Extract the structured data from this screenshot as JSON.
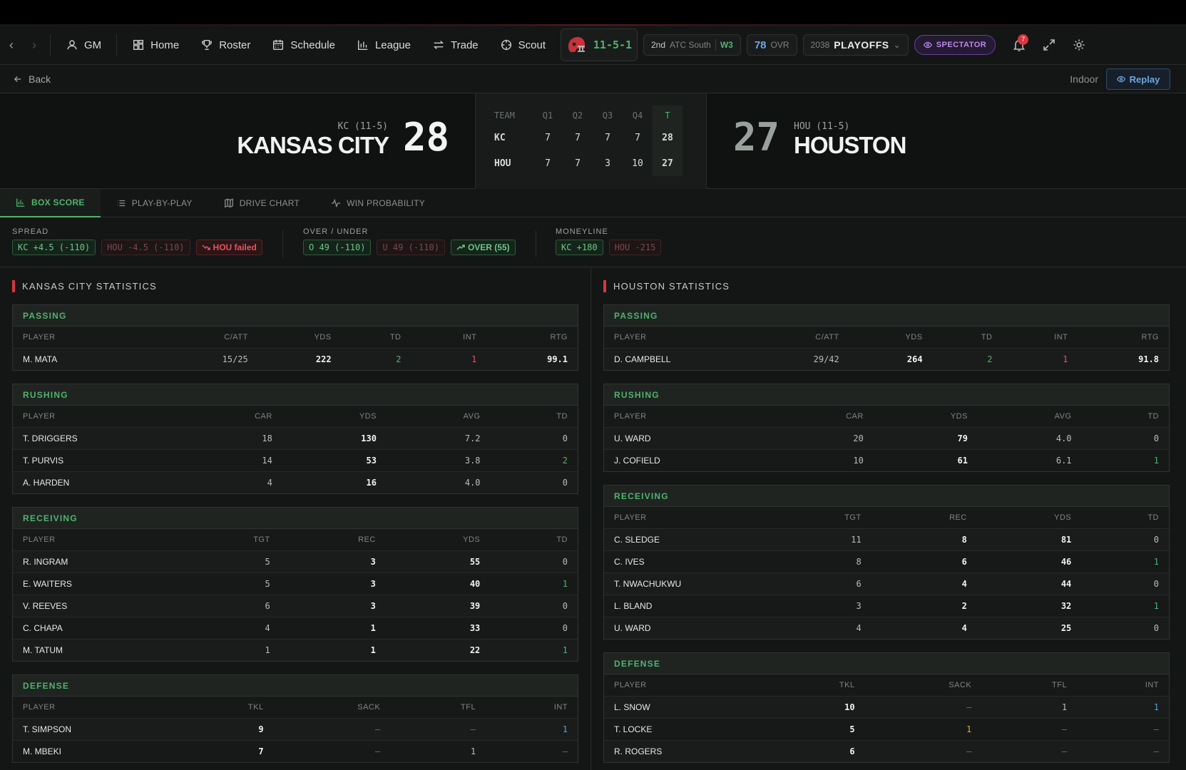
{
  "nav": {
    "gm_label": "GM",
    "items": [
      {
        "label": "Home",
        "icon": "home-grid-icon"
      },
      {
        "label": "Roster",
        "icon": "trophy-icon"
      },
      {
        "label": "Schedule",
        "icon": "calendar-icon"
      },
      {
        "label": "League",
        "icon": "bar-chart-icon"
      },
      {
        "label": "Trade",
        "icon": "swap-icon"
      },
      {
        "label": "Scout",
        "icon": "crosshair-icon"
      }
    ],
    "record": "11-5-1",
    "standing_rank": "2nd",
    "standing_division": "ATC South",
    "standing_streak": "W3",
    "ovr_value": "78",
    "ovr_label": "OVR",
    "season_year": "2038",
    "season_phase": "PLAYOFFS",
    "spectator_label": "SPECTATOR",
    "notification_count": "7",
    "colors": {
      "accent": "#4fb36e",
      "alert": "#d9363e",
      "spectator": "#b98be8",
      "ovr": "#6aa7e6"
    }
  },
  "subbar": {
    "back_label": "Back",
    "venue": "Indoor",
    "replay_label": "Replay"
  },
  "scoreboard": {
    "home": {
      "record": "KC (11-5)",
      "name": "KANSAS CITY",
      "score": "28"
    },
    "away": {
      "record": "HOU (11-5)",
      "name": "HOUSTON",
      "score": "27"
    },
    "linescore": {
      "headers": [
        "TEAM",
        "Q1",
        "Q2",
        "Q3",
        "Q4",
        "T"
      ],
      "rows": [
        [
          "KC",
          "7",
          "7",
          "7",
          "7",
          "28"
        ],
        [
          "HOU",
          "7",
          "7",
          "3",
          "10",
          "27"
        ]
      ]
    }
  },
  "tabs": [
    "BOX SCORE",
    "PLAY-BY-PLAY",
    "DRIVE CHART",
    "WIN PROBABILITY"
  ],
  "betting": {
    "spread": {
      "label": "SPREAD",
      "kc": "KC +4.5 (-110)",
      "hou": "HOU -4.5 (-110)",
      "result": "HOU failed"
    },
    "over_under": {
      "label": "OVER / UNDER",
      "over": "O 49 (-110)",
      "under": "U 49 (-110)",
      "result": "OVER (55)"
    },
    "moneyline": {
      "label": "MONEYLINE",
      "kc": "KC +180",
      "hou": "HOU -215"
    }
  },
  "stats": {
    "kc": {
      "title": "KANSAS CITY STATISTICS",
      "passing": {
        "title": "PASSING",
        "headers": [
          "PLAYER",
          "C/ATT",
          "YDS",
          "TD",
          "INT",
          "RTG"
        ],
        "rows": [
          [
            "M. MATA",
            "15/25",
            "222",
            "2",
            "1",
            "99.1"
          ]
        ]
      },
      "rushing": {
        "title": "RUSHING",
        "headers": [
          "PLAYER",
          "CAR",
          "YDS",
          "AVG",
          "TD"
        ],
        "rows": [
          [
            "T. DRIGGERS",
            "18",
            "130",
            "7.2",
            "0"
          ],
          [
            "T. PURVIS",
            "14",
            "53",
            "3.8",
            "2"
          ],
          [
            "A. HARDEN",
            "4",
            "16",
            "4.0",
            "0"
          ]
        ]
      },
      "receiving": {
        "title": "RECEIVING",
        "headers": [
          "PLAYER",
          "TGT",
          "REC",
          "YDS",
          "TD"
        ],
        "rows": [
          [
            "R. INGRAM",
            "5",
            "3",
            "55",
            "0"
          ],
          [
            "E. WAITERS",
            "5",
            "3",
            "40",
            "1"
          ],
          [
            "V. REEVES",
            "6",
            "3",
            "39",
            "0"
          ],
          [
            "C. CHAPA",
            "4",
            "1",
            "33",
            "0"
          ],
          [
            "M. TATUM",
            "1",
            "1",
            "22",
            "1"
          ]
        ]
      },
      "defense": {
        "title": "DEFENSE",
        "headers": [
          "PLAYER",
          "TKL",
          "SACK",
          "TFL",
          "INT"
        ],
        "rows": [
          [
            "T. SIMPSON",
            "9",
            "–",
            "–",
            "1"
          ],
          [
            "M. MBEKI",
            "7",
            "–",
            "1",
            "–"
          ]
        ]
      }
    },
    "hou": {
      "title": "HOUSTON STATISTICS",
      "passing": {
        "title": "PASSING",
        "headers": [
          "PLAYER",
          "C/ATT",
          "YDS",
          "TD",
          "INT",
          "RTG"
        ],
        "rows": [
          [
            "D. CAMPBELL",
            "29/42",
            "264",
            "2",
            "1",
            "91.8"
          ]
        ]
      },
      "rushing": {
        "title": "RUSHING",
        "headers": [
          "PLAYER",
          "CAR",
          "YDS",
          "AVG",
          "TD"
        ],
        "rows": [
          [
            "U. WARD",
            "20",
            "79",
            "4.0",
            "0"
          ],
          [
            "J. COFIELD",
            "10",
            "61",
            "6.1",
            "1"
          ]
        ]
      },
      "receiving": {
        "title": "RECEIVING",
        "headers": [
          "PLAYER",
          "TGT",
          "REC",
          "YDS",
          "TD"
        ],
        "rows": [
          [
            "C. SLEDGE",
            "11",
            "8",
            "81",
            "0"
          ],
          [
            "C. IVES",
            "8",
            "6",
            "46",
            "1"
          ],
          [
            "T. NWACHUKWU",
            "6",
            "4",
            "44",
            "0"
          ],
          [
            "L. BLAND",
            "3",
            "2",
            "32",
            "1"
          ],
          [
            "U. WARD",
            "4",
            "4",
            "25",
            "0"
          ]
        ]
      },
      "defense": {
        "title": "DEFENSE",
        "headers": [
          "PLAYER",
          "TKL",
          "SACK",
          "TFL",
          "INT"
        ],
        "rows": [
          [
            "L. SNOW",
            "10",
            "–",
            "1",
            "1"
          ],
          [
            "T. LOCKE",
            "5",
            "1",
            "–",
            "–"
          ],
          [
            "R. ROGERS",
            "6",
            "–",
            "–",
            "–"
          ]
        ]
      }
    }
  }
}
